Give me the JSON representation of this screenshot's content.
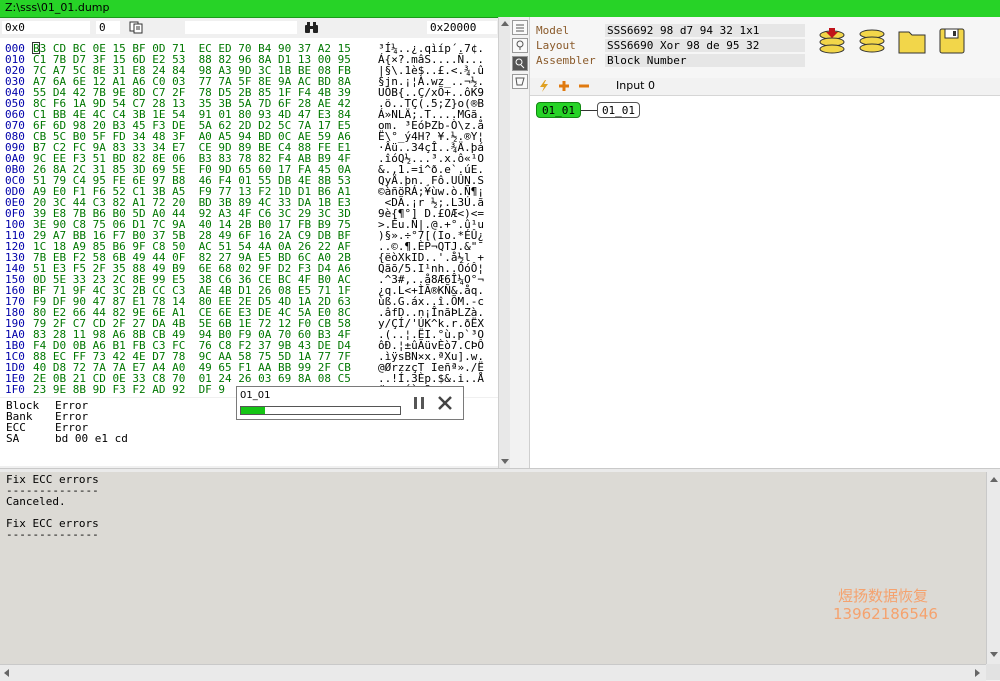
{
  "window": {
    "title": "Z:\\sss\\01_01.dump"
  },
  "toolbar": {
    "offset": "0x0",
    "value": "0",
    "goto_value": "0x20000"
  },
  "hex": {
    "rows": [
      {
        "off": "000",
        "hex": "B3 CD BC 0E 15 BF 0D 71  EC ED 70 B4 90 37 A2 15",
        "ascii": "³Í¼..¿.qìíp´.7¢."
      },
      {
        "off": "010",
        "hex": "C1 7B D7 3F 15 6D E2 53  88 82 96 8A D1 13 00 95",
        "ascii": "Á{×?.mâS....Ñ..."
      },
      {
        "off": "020",
        "hex": "7C A7 5C 8E 31 E8 24 84  98 A3 9D 3C 1B BE 08 FB",
        "ascii": "|§\\.1è$..£.<.¾.û"
      },
      {
        "off": "030",
        "hex": "A7 6A 6E 12 A1 A6 C0 03  77 7A 5F 8E 9A AC BD 8A",
        "ascii": "§jn.¡¦À.wz_..¬½."
      },
      {
        "off": "040",
        "hex": "55 D4 42 7B 9E 8D C7 2F  78 D5 2B 85 1F F4 4B 39",
        "ascii": "UÔB{..Ç/xÕ+..ôK9"
      },
      {
        "off": "050",
        "hex": "8C F6 1A 9D 54 C7 28 13  35 3B 5A 7D 6F 28 AE 42",
        "ascii": ".ö..TÇ(.5;Z}o(®B"
      },
      {
        "off": "060",
        "hex": "C1 BB 4E 4C C4 3B 1E 54  91 01 80 93 4D 47 E3 84",
        "ascii": "Á»NLÄ;.T....MGã."
      },
      {
        "off": "070",
        "hex": "6F 6D 98 20 B3 45 F3 DE  5A 62 2D D2 5C 7A 17 E5",
        "ascii": "om. ³EóÞZb-Ò\\z.å"
      },
      {
        "off": "080",
        "hex": "CB 5C B0 5F FD 34 48 3F  A0 A5 94 BD 0C AE 59 A6",
        "ascii": "Ë\\°_ý4H? ¥.½.®Y¦"
      },
      {
        "off": "090",
        "hex": "B7 C2 FC 9A 83 33 34 E7  CE 9D 89 BE C4 88 FE E1",
        "ascii": "·Âü..34çÎ..¾Ä.þá"
      },
      {
        "off": "0A0",
        "hex": "9C EE F3 51 BD 82 8E 06  B3 83 78 82 F4 AB B9 4F",
        "ascii": ".îóQ½...³.x.ô«¹O"
      },
      {
        "off": "0B0",
        "hex": "26 8A 2C 31 85 3D 69 5E  F0 9D 65 60 17 FA 45 0A",
        "ascii": "&.,1.=i^ð.e`.úE."
      },
      {
        "off": "0C0",
        "hex": "51 79 C4 95 FE 6E 97 B8  46 F4 01 55 DB 4E 8B 53",
        "ascii": "QyÄ.þn.¸Fô.UÛN.S"
      },
      {
        "off": "0D0",
        "hex": "A9 E0 F1 F6 52 C1 3B A5  F9 77 13 F2 1D D1 B6 A1",
        "ascii": "©àñöRÁ;¥ùw.ò.Ñ¶¡"
      },
      {
        "off": "0E0",
        "hex": "20 3C 44 C3 82 A1 72 20  BD 3B 89 4C 33 DA 1B E3",
        "ascii": " <DÃ.¡r ½;.L3Ú.ã"
      },
      {
        "off": "0F0",
        "hex": "39 E8 7B B6 B0 5D A0 44  92 A3 4F C6 3C 29 3C 3D",
        "ascii": "9è{¶°] D.£OÆ<)<="
      },
      {
        "off": "100",
        "hex": "3E 90 C8 75 06 D1 7C 9A  40 14 2B B0 17 FB B9 75",
        "ascii": ">.Èu.Ñ|.@.+°.û¹u"
      },
      {
        "off": "110",
        "hex": "29 A7 BB 16 F7 B0 37 5B  28 49 6F 16 2A C9 DB BF",
        "ascii": ")§».÷°7[(Io.*ÉÛ¿"
      },
      {
        "off": "120",
        "hex": "1C 18 A9 85 B6 9F C8 50  AC 51 54 4A 0A 26 22 AF",
        "ascii": "..©.¶.ÈP¬QTJ.&\"¯"
      },
      {
        "off": "130",
        "hex": "7B EB F2 58 6B 49 44 0F  82 27 9A E5 BD 6C A0 2B",
        "ascii": "{ëòXkID..'.å½l +"
      },
      {
        "off": "140",
        "hex": "51 E3 F5 2F 35 88 49 B9  6E 68 02 9F D2 F3 D4 A6",
        "ascii": "Qãõ/5.I¹nh..ÒóÔ¦"
      },
      {
        "off": "150",
        "hex": "0D 5E 33 23 2C 8E 99 E5  38 C6 36 CE BC 4F B0 AC",
        "ascii": ".^3#,..å8Æ6Î¼O°¬"
      },
      {
        "off": "160",
        "hex": "BF 71 9F 4C 3C 2B CC C3  AE 4B D1 26 08 E5 71 1F",
        "ascii": "¿q.L<+ÌÃ®KÑ&.åq."
      },
      {
        "off": "170",
        "hex": "F9 DF 90 47 87 E1 78 14  80 EE 2E D5 4D 1A 2D 63",
        "ascii": "ùß.G.áx..î.ÕM.-c"
      },
      {
        "off": "180",
        "hex": "80 E2 66 44 82 9E 6E A1  CE 6E E3 DE 4C 5A E0 8C",
        "ascii": ".âfD..n¡ÎnãÞLZà."
      },
      {
        "off": "190",
        "hex": "79 2F C7 CD 2F 27 DA 4B  5E 6B 1E 72 12 F0 CB 58",
        "ascii": "y/ÇÍ/'ÚK^k.r.ðËX"
      },
      {
        "off": "1A0",
        "hex": "83 28 11 98 A6 8B CB 49  94 B0 F9 0A 70 60 B3 4F",
        "ascii": ".(..¦.ËI.°ù.p`³O"
      },
      {
        "off": "1B0",
        "hex": "F4 D0 0B A6 B1 FB C3 FC  76 C8 F2 37 9B 43 DE D4",
        "ascii": "ôÐ.¦±ûÃüvÈò7.CÞÔ"
      },
      {
        "off": "1C0",
        "hex": "88 EC FF 73 42 4E D7 78  9C AA 58 75 5D 1A 77 7F",
        "ascii": ".ìÿsBN×x.ªXu].w."
      },
      {
        "off": "1D0",
        "hex": "40 D8 72 7A 7A E7 A4 A0  49 65 F1 AA BB 99 2F CB",
        "ascii": "@ØrzzçΤ Ieñª»./Ë"
      },
      {
        "off": "1E0",
        "hex": "2E 0B 21 CD 0E 33 C8 70  01 24 26 03 69 8A 08 C5",
        "ascii": "..!Í.3Èp.$&.i..Å"
      },
      {
        "off": "1F0",
        "hex": "23 9E 8B 9D F3 F2 AD 92  DF 9",
        "ascii": "#...óò­.ß"
      }
    ]
  },
  "info": {
    "items": [
      {
        "label": "Block",
        "value": "Error"
      },
      {
        "label": "Bank",
        "value": "Error"
      },
      {
        "label": "ECC",
        "value": "Error"
      },
      {
        "label": "SA",
        "value": "bd 00 e1 cd"
      }
    ]
  },
  "progress_dialog": {
    "title": "01_01",
    "progress": 0.15
  },
  "properties": {
    "model_label": "Model",
    "model_value": "SSS6692  98 d7 94 32  1x1",
    "layout_label": "Layout",
    "layout_value": "SSS6690 Xor 98 de 95 32",
    "assembler_label": "Assembler",
    "assembler_value": "Block Number"
  },
  "graph": {
    "input_label": "Input 0",
    "node_source": "01_01",
    "node_target": "01_01"
  },
  "console": {
    "text": "Fix ECC errors\n--------------\nCanceled.\n\nFix ECC errors\n--------------"
  },
  "watermark": {
    "line1": "煜扬数据恢复",
    "line2": "13962186546"
  },
  "colors": {
    "accent_green": "#27d327",
    "hex_green": "#007700",
    "offset_blue": "#0000aa"
  }
}
